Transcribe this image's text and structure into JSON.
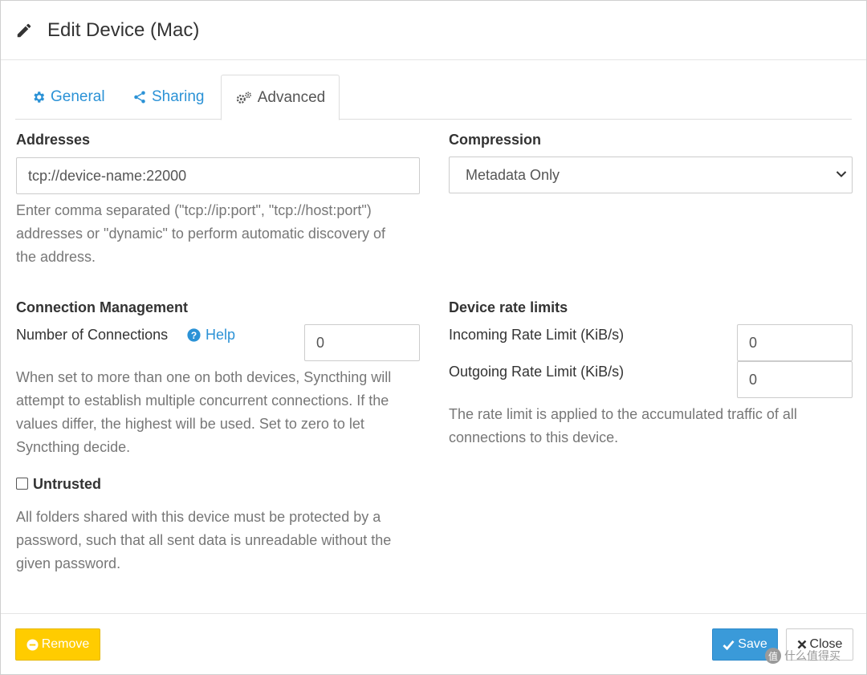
{
  "header": {
    "title": "Edit Device (Mac)",
    "icon": "pencil-icon"
  },
  "tabs": [
    {
      "label": "General",
      "icon": "gear-icon",
      "active": false
    },
    {
      "label": "Sharing",
      "icon": "share-icon",
      "active": false
    },
    {
      "label": "Advanced",
      "icon": "cogs-icon",
      "active": true
    }
  ],
  "addresses": {
    "label": "Addresses",
    "value": "tcp://device-name:22000",
    "help": [
      "Enter comma separated (\"tcp://ip:port\", \"tcp://host:port\")",
      "addresses or \"dynamic\" to perform automatic discovery of",
      "the address."
    ]
  },
  "compression": {
    "label": "Compression",
    "selected": "Metadata Only"
  },
  "connection": {
    "section_label": "Connection Management",
    "num_label": "Number of Connections",
    "help_link": "Help",
    "value": "0",
    "help": [
      "When set to more than one on both devices, Syncthing will",
      "attempt to establish multiple concurrent connections. If the",
      "values differ, the highest will be used. Set to zero to let",
      "Syncthing decide."
    ]
  },
  "rate_limits": {
    "section_label": "Device rate limits",
    "incoming_label": "Incoming Rate Limit (KiB/s)",
    "incoming_value": "0",
    "outgoing_label": "Outgoing Rate Limit (KiB/s)",
    "outgoing_value": "0",
    "help": [
      "The rate limit is applied to the accumulated traffic of all",
      "connections to this device."
    ]
  },
  "untrusted": {
    "label": "Untrusted",
    "checked": false,
    "help": [
      "All folders shared with this device must be protected by a",
      "password, such that all sent data is unreadable without the",
      "given password."
    ]
  },
  "footer": {
    "remove_label": "Remove",
    "save_label": "Save",
    "close_label": "Close"
  },
  "watermark": {
    "text": "什么值得买",
    "badge": "值"
  },
  "colors": {
    "link": "#2b92d6",
    "remove": "#ffcc00",
    "save": "#3a9ad9"
  }
}
